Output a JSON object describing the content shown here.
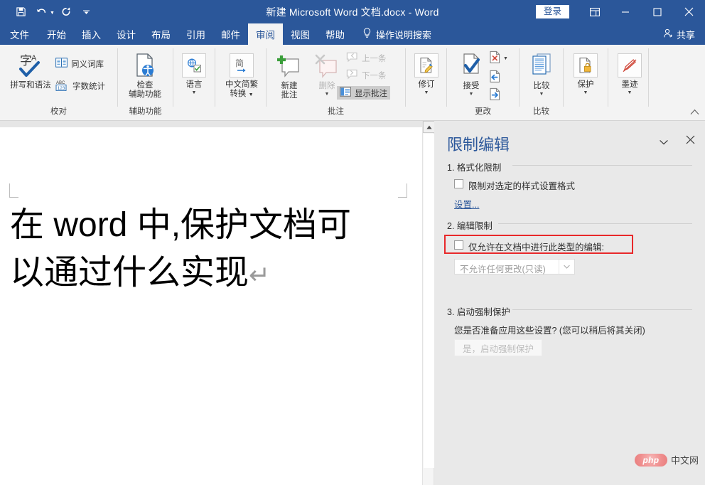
{
  "titlebar": {
    "document_title": "新建 Microsoft Word 文档.docx  -  Word",
    "quick_access": [
      {
        "name": "save-icon",
        "label": "保存"
      },
      {
        "name": "undo-icon",
        "label": "撤消"
      },
      {
        "name": "redo-icon",
        "label": "恢复"
      },
      {
        "name": "customize-qat-icon",
        "label": "自定义快速访问工具栏"
      }
    ],
    "signin_label": "登录",
    "ribbon_display_options": "功能区显示选项",
    "minimize": "最小化",
    "maximize": "最大化",
    "close": "关闭"
  },
  "tabs": [
    {
      "label": "文件",
      "active": false
    },
    {
      "label": "开始",
      "active": false
    },
    {
      "label": "插入",
      "active": false
    },
    {
      "label": "设计",
      "active": false
    },
    {
      "label": "布局",
      "active": false
    },
    {
      "label": "引用",
      "active": false
    },
    {
      "label": "邮件",
      "active": false
    },
    {
      "label": "审阅",
      "active": true
    },
    {
      "label": "视图",
      "active": false
    },
    {
      "label": "帮助",
      "active": false
    }
  ],
  "tellme": {
    "label": "操作说明搜索",
    "icon": "lightbulb-icon"
  },
  "share": {
    "label": "共享",
    "icon": "share-person-icon"
  },
  "ribbon": {
    "groups": [
      {
        "label": "校对"
      },
      {
        "label": "辅助功能"
      },
      {
        "label": ""
      },
      {
        "label": ""
      },
      {
        "label": "批注"
      },
      {
        "label": "更改"
      },
      {
        "label": "比较"
      },
      {
        "label": ""
      },
      {
        "label": ""
      }
    ],
    "buttons": {
      "spelling_grammar": "拼写和语法",
      "thesaurus": "同义词库",
      "word_count": "字数统计",
      "check_accessibility_line1": "检查",
      "check_accessibility_line2": "辅助功能",
      "language": "语言",
      "chinese_conversion_line1": "中文简繁",
      "chinese_conversion_line2": "转换",
      "new_comment_line1": "新建",
      "new_comment_line2": "批注",
      "delete_comment": "删除",
      "previous_comment": "上一条",
      "next_comment": "下一条",
      "show_comments": "显示批注",
      "track_changes": "修订",
      "accept": "接受",
      "compare": "比较",
      "protect": "保护",
      "ink": "墨迹"
    },
    "collapse_label": "折叠功能区"
  },
  "document": {
    "line1": "在 word 中,保护文档可",
    "line2": "以通过什么实现",
    "paragraph_mark": "↵"
  },
  "scrollbar": {
    "up_arrow": "▲"
  },
  "pane": {
    "title": "限制编辑",
    "dropdown_icon": "chevron-down-icon",
    "close_icon": "close-icon",
    "section1": {
      "heading": "1. 格式化限制",
      "checkbox_label": "限制对选定的样式设置格式",
      "checkbox_checked": false,
      "settings_link": "设置..."
    },
    "section2": {
      "heading": "2. 编辑限制",
      "checkbox_label": "仅允许在文档中进行此类型的编辑:",
      "checkbox_checked": false,
      "highlighted": true,
      "highlight_color": "#e8282a",
      "combo_value": "不允许任何更改(只读)",
      "combo_disabled": true
    },
    "section3": {
      "heading": "3. 启动强制保护",
      "prompt": "您是否准备应用这些设置? (您可以稍后将其关闭)",
      "button_label": "是，启动强制保护",
      "button_disabled": true
    }
  },
  "watermark": {
    "logo": "php",
    "text": "中文网"
  },
  "colors": {
    "word_blue": "#2b579a",
    "ribbon_bg": "#f3f3f3",
    "pane_bg": "#e9e9e9",
    "highlight_red": "#e8282a",
    "link_blue": "#2b579a"
  }
}
